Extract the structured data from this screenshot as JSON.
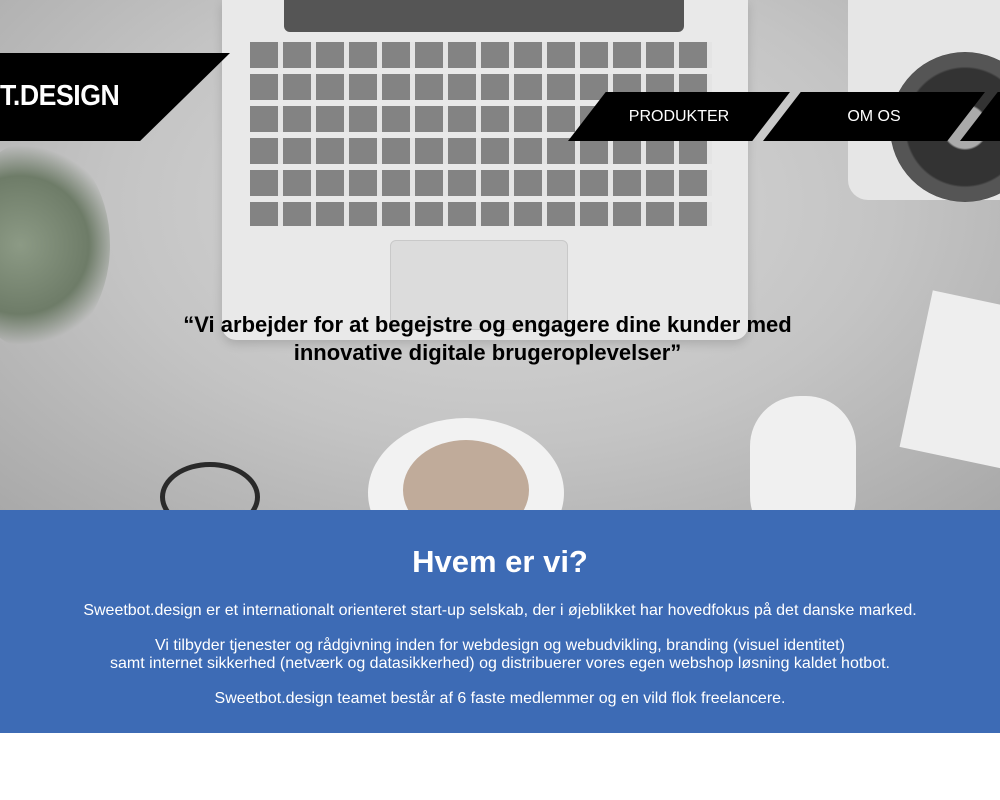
{
  "header": {
    "logo_text": "T.DESIGN",
    "nav": [
      {
        "label": "PRODUKTER"
      },
      {
        "label": "OM OS"
      },
      {
        "label": ""
      }
    ]
  },
  "hero": {
    "quote_line1": "“Vi arbejder for at begejstre og engagere dine kunder med",
    "quote_line2": "innovative digitale brugeroplevelser”"
  },
  "about": {
    "title": "Hvem er vi?",
    "p1": "Sweetbot.design er et internationalt orienteret start-up selskab, der i øjeblikket har hovedfokus på det danske marked.",
    "p2_line1": "Vi tilbyder tjenester og rådgivning inden for webdesign og webudvikling, branding (visuel identitet)",
    "p2_line2": "samt internet sikkerhed (netværk og datasikkerhed) og distribuerer vores egen webshop løsning kaldet hotbot.",
    "p3": "Sweetbot.design teamet består af 6 faste medlemmer og en vild flok freelancere.",
    "background": "#3d6bb5"
  }
}
